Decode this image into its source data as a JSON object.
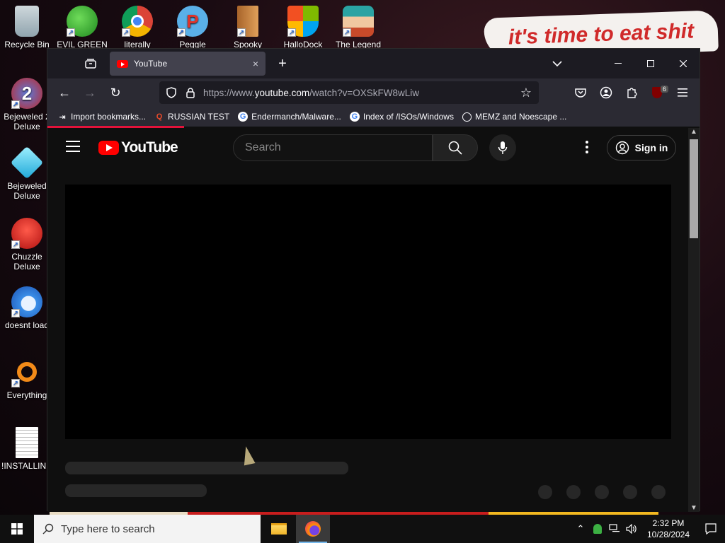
{
  "desktop": {
    "wallpaper_text": "it's time to eat shit",
    "icons": [
      {
        "label": "Recycle Bin",
        "icon": "recycle-bin-icon"
      },
      {
        "label": "EVIL GREEN",
        "icon": "messenger-icon"
      },
      {
        "label": "literally",
        "icon": "chrome-icon"
      },
      {
        "label": "Peggle Nights",
        "icon": "peggle-icon"
      },
      {
        "label": "Spooky",
        "icon": "door-icon"
      },
      {
        "label": "HalloDock",
        "icon": "windows-logo-icon"
      },
      {
        "label": "The Legend",
        "icon": "pixel-character-icon"
      },
      {
        "label": "Bejeweled 2 Deluxe",
        "icon": "bejeweled2-icon"
      },
      {
        "label": "Bejeweled Deluxe",
        "icon": "diamond-icon"
      },
      {
        "label": "Chuzzle Deluxe",
        "icon": "chuzzle-icon"
      },
      {
        "label": "doesnt load",
        "icon": "thunderbird-icon"
      },
      {
        "label": "Everything",
        "icon": "magnifier-icon"
      },
      {
        "label": "!INSTALLIN...",
        "icon": "text-file-icon"
      }
    ]
  },
  "browser": {
    "tab": {
      "title": "YouTube",
      "close": "×"
    },
    "new_tab": "+",
    "url": {
      "prefix": "https://www.",
      "host": "youtube.com",
      "path": "/watch?v=OXSkFW8wLiw"
    },
    "bookmarks": [
      {
        "label": "Import bookmarks...",
        "icon": "import-icon"
      },
      {
        "label": "RUSSIAN TEST",
        "icon": "q-logo-icon"
      },
      {
        "label": "Endermanch/Malware...",
        "icon": "google-icon"
      },
      {
        "label": "Index of /ISOs/Windows",
        "icon": "google-icon"
      },
      {
        "label": "MEMZ and Noescape ...",
        "icon": "globe-icon"
      }
    ],
    "extension_badge": "6",
    "load_progress": 0.21
  },
  "youtube": {
    "logo_text": "YouTube",
    "search_placeholder": "Search",
    "signin_label": "Sign in"
  },
  "taskbar": {
    "search_placeholder": "Type here to search",
    "time": "2:32 PM",
    "date": "10/28/2024"
  },
  "colors": {
    "youtube_red": "#ff0000",
    "firefox_tab": "#42414d",
    "firefox_chrome": "#2b2a33",
    "page_bg": "#0f0f0f",
    "skeleton": "#272727"
  }
}
